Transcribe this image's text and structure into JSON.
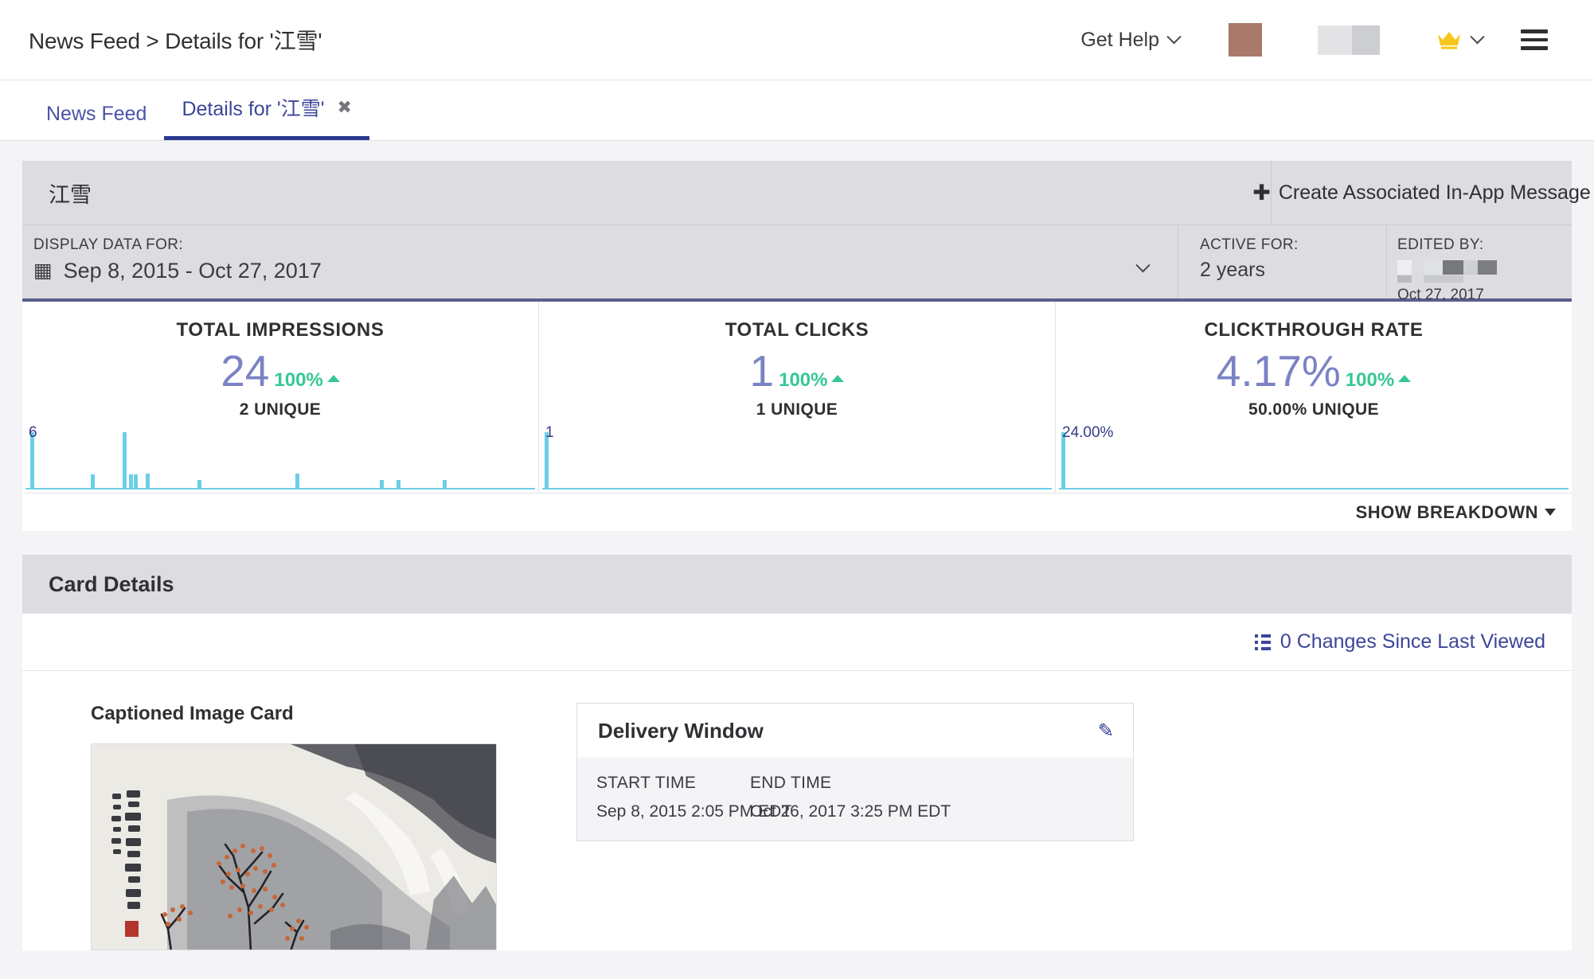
{
  "topbar": {
    "breadcrumb": "News Feed > Details for '江雪'",
    "get_help": "Get Help",
    "icons": {
      "chevron": "chevron-down-icon",
      "crown": "crown-icon",
      "menu": "hamburger-menu-icon"
    }
  },
  "tabs": [
    {
      "label": "News Feed",
      "active": false
    },
    {
      "label": "Details for '江雪'",
      "active": true,
      "close": "✖"
    }
  ],
  "panel": {
    "title": "江雪",
    "create_associated": "Create Associated In-App Message",
    "plus": "✚",
    "display_data_label": "DISPLAY DATA FOR:",
    "date_range": "Sep 8, 2015 - Oct 27, 2017",
    "calendar_icon": "▦",
    "active_for_label": "ACTIVE FOR:",
    "active_for_value": "2 years",
    "edited_by_label": "EDITED BY:",
    "edited_by_date": "Oct 27, 2017"
  },
  "metrics": [
    {
      "title": "TOTAL IMPRESSIONS",
      "value": "24",
      "delta": "100%",
      "delta_direction": "up",
      "sub": "2 UNIQUE"
    },
    {
      "title": "TOTAL CLICKS",
      "value": "1",
      "delta": "100%",
      "delta_direction": "up",
      "sub": "1 UNIQUE"
    },
    {
      "title": "CLICKTHROUGH RATE",
      "value": "4.17%",
      "delta": "100%",
      "delta_direction": "up",
      "sub": "50.00% UNIQUE"
    }
  ],
  "chart_data": [
    {
      "type": "bar",
      "title": "Total Impressions sparkline",
      "ymax_label": "6",
      "ylim": [
        0,
        6
      ],
      "grid": false,
      "series": [
        {
          "name": "impressions",
          "points": [
            {
              "x": 0.01,
              "y": 6
            },
            {
              "x": 0.128,
              "y": 1.6
            },
            {
              "x": 0.19,
              "y": 6
            },
            {
              "x": 0.203,
              "y": 1.6
            },
            {
              "x": 0.212,
              "y": 1.6
            },
            {
              "x": 0.236,
              "y": 1.7
            },
            {
              "x": 0.337,
              "y": 1.0
            },
            {
              "x": 0.53,
              "y": 1.7
            },
            {
              "x": 0.695,
              "y": 1.0
            },
            {
              "x": 0.728,
              "y": 1.0
            },
            {
              "x": 0.818,
              "y": 1.0
            }
          ]
        }
      ]
    },
    {
      "type": "bar",
      "title": "Total Clicks sparkline",
      "ymax_label": "1",
      "ylim": [
        0,
        1
      ],
      "grid": false,
      "series": [
        {
          "name": "clicks",
          "points": [
            {
              "x": 0.005,
              "y": 1
            }
          ]
        }
      ]
    },
    {
      "type": "bar",
      "title": "Clickthrough Rate sparkline",
      "ymax_label": "24.00%",
      "ylim": [
        0,
        24
      ],
      "grid": false,
      "series": [
        {
          "name": "ctr",
          "points": [
            {
              "x": 0.005,
              "y": 24
            }
          ]
        }
      ]
    }
  ],
  "breakdown": {
    "label": "SHOW BREAKDOWN"
  },
  "card_details": {
    "heading": "Card Details",
    "changes_link": "0 Changes Since Last Viewed",
    "card_type_label": "Captioned Image Card",
    "delivery_window": {
      "heading": "Delivery Window",
      "edit_icon": "✎",
      "start_label": "START TIME",
      "end_label": "END TIME",
      "start_value": "Sep 8, 2015 2:05 PM EDT",
      "end_value": "Oct 26, 2017 3:25 PM EDT"
    }
  },
  "colors": {
    "metric_value": "#7b83c4",
    "delta_green": "#35c892",
    "spark_blue": "#6ccfe6",
    "link_blue": "#3c4699",
    "tab_underline": "#2a3a90",
    "panel_grey": "#dddde1",
    "crown_yellow": "#f6c71b"
  }
}
